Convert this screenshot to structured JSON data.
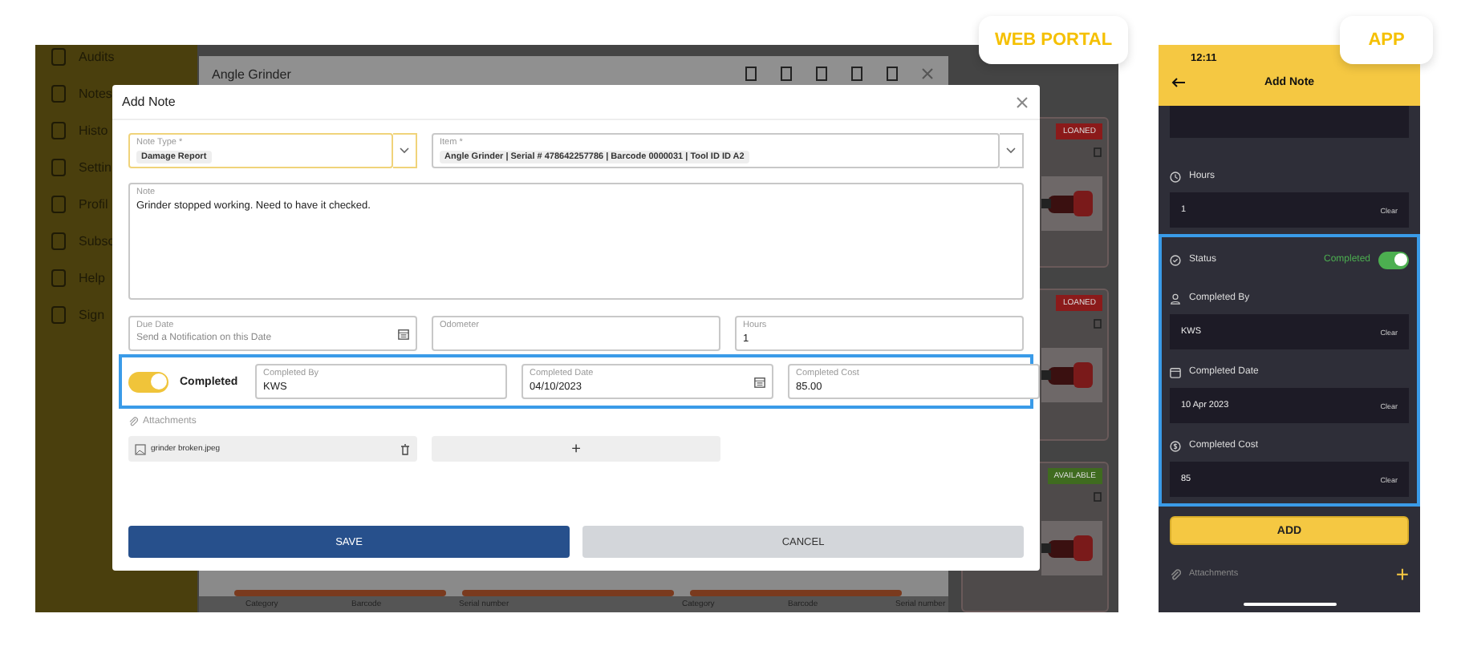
{
  "web_portal": {
    "label": "WEB PORTAL",
    "sidebar": {
      "items": [
        {
          "label": "Audits"
        },
        {
          "label": "Notes"
        },
        {
          "label": "Histo"
        },
        {
          "label": "Settin"
        },
        {
          "label": "Profil"
        },
        {
          "label": "Subsc"
        },
        {
          "label": "Help"
        },
        {
          "label": "Sign"
        }
      ]
    },
    "background_panel": {
      "title": "Angle Grinder",
      "footer_labels": [
        "Category",
        "Barcode",
        "Serial number",
        "Category",
        "Barcode",
        "Serial number"
      ]
    },
    "cards": [
      {
        "badge": "LOANED",
        "color": "#8b1a1a"
      },
      {
        "badge": "LOANED",
        "color": "#8b1a1a"
      },
      {
        "badge": "AVAILABLE",
        "color": "#3f6b1f"
      }
    ],
    "add_note_dialog": {
      "title": "Add Note",
      "note_type": {
        "label": "Note Type *",
        "value": "Damage Report"
      },
      "item": {
        "label": "Item *",
        "value": "Angle Grinder | Serial # 478642257786 | Barcode 0000031 | Tool ID ID A2"
      },
      "note": {
        "label": "Note",
        "value": "Grinder stopped working. Need to have it checked."
      },
      "due_date": {
        "label": "Due Date",
        "placeholder": "Send a Notification on this Date"
      },
      "odometer": {
        "label": "Odometer"
      },
      "hours": {
        "label": "Hours",
        "value": "1"
      },
      "completed": {
        "label": "Completed",
        "on": true
      },
      "completed_by": {
        "label": "Completed By",
        "value": "KWS"
      },
      "completed_date": {
        "label": "Completed Date",
        "value": "04/10/2023"
      },
      "completed_cost": {
        "label": "Completed Cost",
        "value": "85.00"
      },
      "attachments": {
        "label": "Attachments",
        "files": [
          {
            "name": "grinder broken.jpeg"
          }
        ],
        "add_button": "+"
      },
      "buttons": {
        "save": "SAVE",
        "cancel": "CANCEL"
      }
    }
  },
  "app": {
    "label": "APP",
    "time": "12:11",
    "title": "Add Note",
    "rows": [
      {
        "kind": "field",
        "label": "Hours",
        "value": "1",
        "clear": "Clear"
      },
      {
        "kind": "toggle",
        "label": "Status",
        "status": "Completed",
        "on": true
      },
      {
        "kind": "field",
        "label": "Completed By",
        "value": "KWS",
        "clear": "Clear"
      },
      {
        "kind": "field",
        "label": "Completed Date",
        "value": "10 Apr 2023",
        "clear": "Clear"
      },
      {
        "kind": "field",
        "label": "Completed Cost",
        "value": "85",
        "clear": "Clear"
      }
    ],
    "add_button": "ADD",
    "attachments": {
      "label": "Attachments",
      "add_button": "+"
    }
  }
}
